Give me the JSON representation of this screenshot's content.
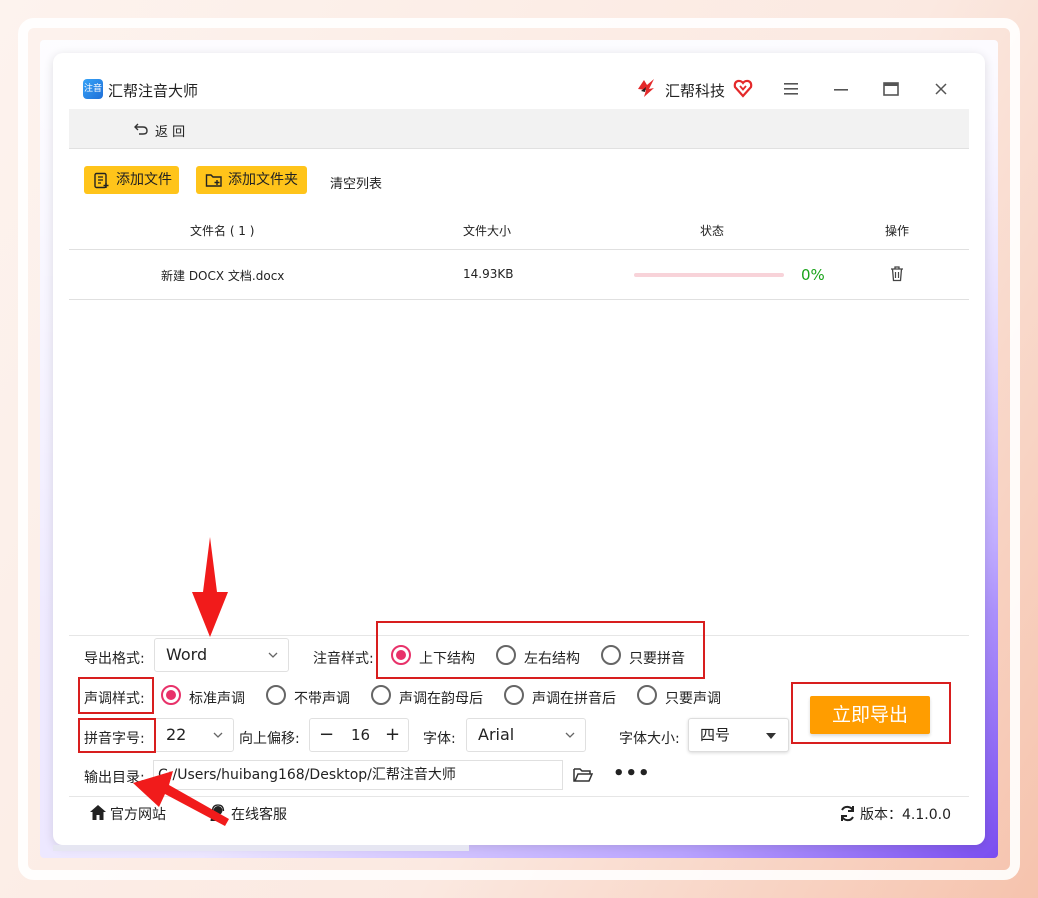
{
  "app": {
    "title": "汇帮注音大师",
    "logo_text": "注音",
    "brand_name": "汇帮科技",
    "menu_icon": "hamburger-icon",
    "minimize_icon": "minimize-icon",
    "maximize_icon": "maximize-icon",
    "close_icon": "close-icon"
  },
  "nav": {
    "back_label": "返 回"
  },
  "toolbar": {
    "add_file": "添加文件",
    "add_folder": "添加文件夹",
    "clear_list": "清空列表"
  },
  "table": {
    "headers": {
      "name": "文件名 ( 1 )",
      "size": "文件大小",
      "status": "状态",
      "action": "操作"
    },
    "rows": [
      {
        "name": "新建 DOCX 文档.docx",
        "size": "14.93KB",
        "progress": 0,
        "progress_text": "0%"
      }
    ]
  },
  "settings": {
    "export_format_label": "导出格式:",
    "export_format_value": "Word",
    "annotation_style_label": "注音样式:",
    "annotation_options": [
      {
        "label": "上下结构",
        "selected": true
      },
      {
        "label": "左右结构",
        "selected": false
      },
      {
        "label": "只要拼音",
        "selected": false
      }
    ],
    "tone_style_label": "声调样式:",
    "tone_options": [
      {
        "label": "标准声调",
        "selected": true
      },
      {
        "label": "不带声调",
        "selected": false
      },
      {
        "label": "声调在韵母后",
        "selected": false
      },
      {
        "label": "声调在拼音后",
        "selected": false
      },
      {
        "label": "只要声调",
        "selected": false
      }
    ],
    "pinyin_size_label": "拼音字号:",
    "pinyin_size_value": "22",
    "offset_label": "向上偏移:",
    "offset_minus": "−",
    "offset_value": "16",
    "offset_plus": "+",
    "font_label": "字体:",
    "font_value": "Arial",
    "font_size_label": "字体大小:",
    "font_size_value": "四号",
    "output_dir_label": "输出目录:",
    "output_dir_value": "C:/Users/huibang168/Desktop/汇帮注音大师",
    "more_label": "•••"
  },
  "export_button": "立即导出",
  "footer": {
    "website": "官方网站",
    "support": "在线客服",
    "version": "版本：4.1.0.0"
  },
  "colors": {
    "accent_yellow": "#ffc41a",
    "export_orange": "#ff9d00",
    "radio_pink": "#e8326a",
    "annotation_red": "#d81e1e",
    "progress_track": "#f8d3d9",
    "percent_green": "#1aa31a"
  }
}
